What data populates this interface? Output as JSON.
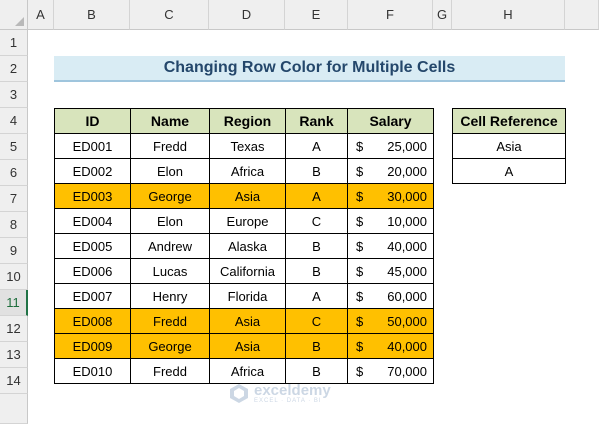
{
  "columns": [
    "A",
    "B",
    "C",
    "D",
    "E",
    "F",
    "G",
    "H"
  ],
  "rows": [
    "1",
    "2",
    "3",
    "4",
    "5",
    "6",
    "7",
    "8",
    "9",
    "10",
    "11",
    "12",
    "13",
    "14"
  ],
  "selected_row": "11",
  "title": "Changing Row Color for Multiple Cells",
  "table": {
    "headers": [
      "ID",
      "Name",
      "Region",
      "Rank",
      "Salary"
    ],
    "currency": "$",
    "rows": [
      {
        "id": "ED001",
        "name": "Fredd",
        "region": "Texas",
        "rank": "A",
        "salary": "25,000",
        "highlight": false
      },
      {
        "id": "ED002",
        "name": "Elon",
        "region": "Africa",
        "rank": "B",
        "salary": "20,000",
        "highlight": false
      },
      {
        "id": "ED003",
        "name": "George",
        "region": "Asia",
        "rank": "A",
        "salary": "30,000",
        "highlight": true
      },
      {
        "id": "ED004",
        "name": "Elon",
        "region": "Europe",
        "rank": "C",
        "salary": "10,000",
        "highlight": false
      },
      {
        "id": "ED005",
        "name": "Andrew",
        "region": "Alaska",
        "rank": "B",
        "salary": "40,000",
        "highlight": false
      },
      {
        "id": "ED006",
        "name": "Lucas",
        "region": "California",
        "rank": "B",
        "salary": "45,000",
        "highlight": false
      },
      {
        "id": "ED007",
        "name": "Henry",
        "region": "Florida",
        "rank": "A",
        "salary": "60,000",
        "highlight": false
      },
      {
        "id": "ED008",
        "name": "Fredd",
        "region": "Asia",
        "rank": "C",
        "salary": "50,000",
        "highlight": true
      },
      {
        "id": "ED009",
        "name": "George",
        "region": "Asia",
        "rank": "B",
        "salary": "40,000",
        "highlight": true
      },
      {
        "id": "ED010",
        "name": "Fredd",
        "region": "Africa",
        "rank": "B",
        "salary": "70,000",
        "highlight": false
      }
    ]
  },
  "reference": {
    "header": "Cell Reference",
    "values": [
      "Asia",
      "A"
    ]
  },
  "watermark": {
    "name": "exceldemy",
    "tagline": "EXCEL · DATA · BI"
  },
  "colors": {
    "highlight": "#ffc000",
    "header_fill": "#d8e4bc",
    "title_fill": "#d9ecf4"
  }
}
